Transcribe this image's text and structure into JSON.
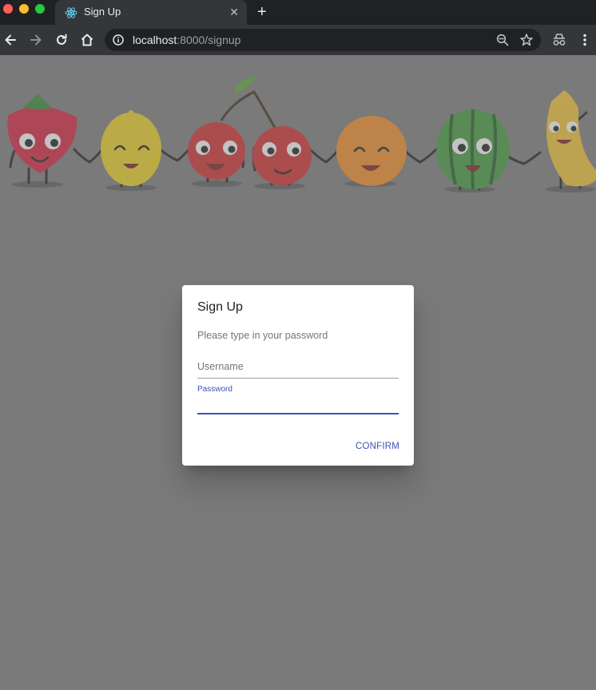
{
  "browser": {
    "tab": {
      "title": "Sign Up",
      "close_glyph": "✕",
      "icon": "react-icon"
    },
    "new_tab_glyph": "+",
    "address": {
      "host": "localhost",
      "rest": ":8000/signup"
    },
    "icons": [
      "back-arrow-icon",
      "forward-arrow-icon",
      "reload-icon",
      "home-icon",
      "info-icon",
      "zoom-icon",
      "star-icon",
      "incognito-icon",
      "menu-icon"
    ]
  },
  "banner": {
    "fruits": [
      "strawberry",
      "lemon",
      "cherry",
      "cherry",
      "orange",
      "watermelon",
      "banana"
    ]
  },
  "dialog": {
    "title": "Sign Up",
    "text": "Please type in your password",
    "username_label": "Username",
    "password_label": "Password",
    "password_value": "",
    "confirm_label": "CONFIRM"
  },
  "colors": {
    "accent": "#3f51b5",
    "overlay": "#7a7a7a",
    "chrome_dark": "#202124",
    "chrome_mid": "#35363a"
  }
}
